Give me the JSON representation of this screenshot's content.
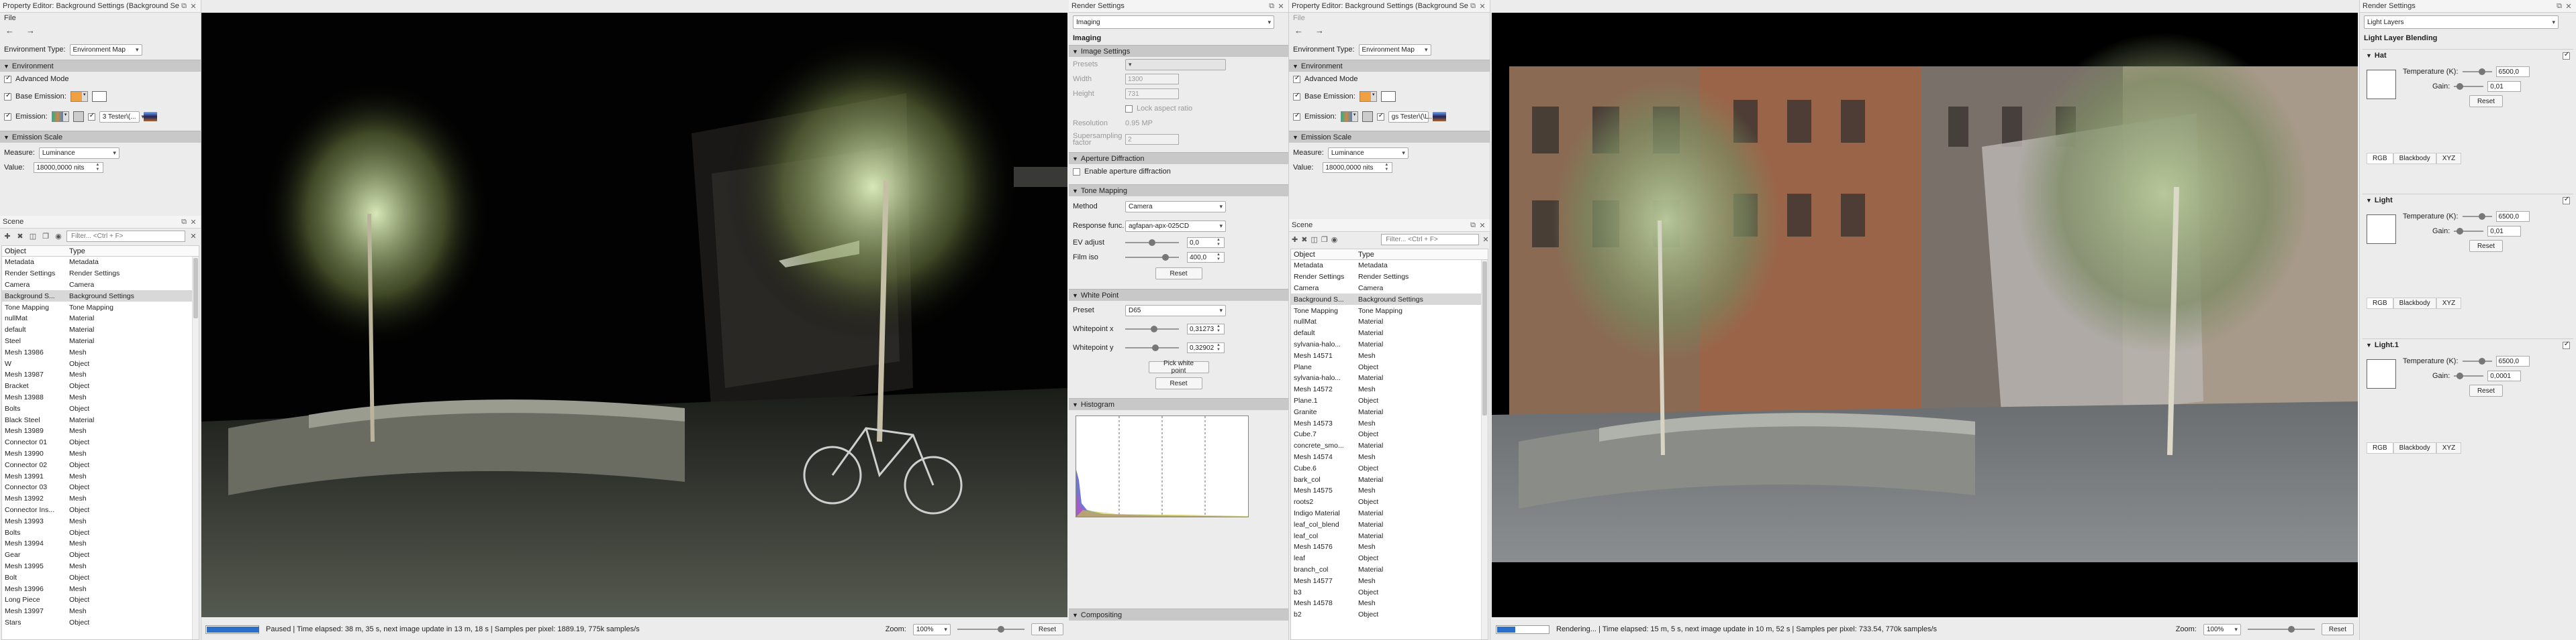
{
  "left_editor": {
    "title": "Property Editor: Background Settings (Background Settings)",
    "menu_file": "File",
    "nav_back": "←",
    "nav_forward": "→",
    "env_type_label": "Environment Type:",
    "env_type_value": "Environment Map",
    "section_environment": "Environment",
    "advanced_mode": "Advanced Mode",
    "base_emission": "Base Emission:",
    "emission_label": "Emission:",
    "emission_map": "3 Tester\\(...",
    "section_emission_scale": "Emission Scale",
    "measure_label": "Measure:",
    "measure_value": "Luminance",
    "value_label": "Value:",
    "value_value": "18000,0000 nits"
  },
  "left_scene": {
    "title": "Scene",
    "filter_placeholder": "Filter... <Ctrl + F>",
    "col_object": "Object",
    "col_type": "Type",
    "rows": [
      [
        "Metadata",
        "Metadata"
      ],
      [
        "Render Settings",
        "Render Settings"
      ],
      [
        "Camera",
        "Camera"
      ],
      [
        "Background S...",
        "Background Settings"
      ],
      [
        "Tone Mapping",
        "Tone Mapping"
      ],
      [
        "nullMat",
        "Material"
      ],
      [
        "default",
        "Material"
      ],
      [
        "Steel",
        "Material"
      ],
      [
        "Mesh 13986",
        "Mesh"
      ],
      [
        "W",
        "Object"
      ],
      [
        "Mesh 13987",
        "Mesh"
      ],
      [
        "Bracket",
        "Object"
      ],
      [
        "Mesh 13988",
        "Mesh"
      ],
      [
        "Bolts",
        "Object"
      ],
      [
        "Black Steel",
        "Material"
      ],
      [
        "Mesh 13989",
        "Mesh"
      ],
      [
        "Connector 01",
        "Object"
      ],
      [
        "Mesh 13990",
        "Mesh"
      ],
      [
        "Connector 02",
        "Object"
      ],
      [
        "Mesh 13991",
        "Mesh"
      ],
      [
        "Connector 03",
        "Object"
      ],
      [
        "Mesh 13992",
        "Mesh"
      ],
      [
        "Connector Ins...",
        "Object"
      ],
      [
        "Mesh 13993",
        "Mesh"
      ],
      [
        "Bolts",
        "Object"
      ],
      [
        "Mesh 13994",
        "Mesh"
      ],
      [
        "Gear",
        "Object"
      ],
      [
        "Mesh 13995",
        "Mesh"
      ],
      [
        "Bolt",
        "Object"
      ],
      [
        "Mesh 13996",
        "Mesh"
      ],
      [
        "Long Piece",
        "Object"
      ],
      [
        "Mesh 13997",
        "Mesh"
      ],
      [
        "Stars",
        "Object"
      ]
    ],
    "selected_index": 3
  },
  "left_status": {
    "status_text": "Paused | Time elapsed: 38 m, 35 s, next image update in 13 m, 18 s | Samples per pixel: 1889.19, 775k samples/s",
    "zoom_label": "Zoom:",
    "zoom_value": "100%",
    "reset": "Reset",
    "progress": 1.0
  },
  "render_settings": {
    "title": "Render Settings",
    "mode_value": "Imaging",
    "heading": "Imaging",
    "section_image_settings": "Image Settings",
    "presets_label": "Presets",
    "width_label": "Width",
    "width_value": "1300",
    "height_label": "Height",
    "height_value": "731",
    "lock_aspect": "Lock aspect ratio",
    "resolution_label": "Resolution",
    "resolution_value": "0.95 MP",
    "supersampling_label": "Supersampling factor",
    "supersampling_value": "2",
    "section_aperture": "Aperture Diffraction",
    "enable_aperture": "Enable aperture diffraction",
    "section_tone": "Tone Mapping",
    "method_label": "Method",
    "method_value": "Camera",
    "response_label": "Response func.",
    "response_value": "agfapan-apx-025CD",
    "ev_label": "EV adjust",
    "ev_value": "0,0",
    "film_label": "Film iso",
    "film_value": "400,0",
    "reset": "Reset",
    "section_white": "White Point",
    "preset_label": "Preset",
    "preset_value": "D65",
    "wx_label": "Whitepoint x",
    "wx_value": "0,31273",
    "wy_label": "Whitepoint y",
    "wy_value": "0,32902",
    "pick_white": "Pick white point",
    "reset2": "Reset",
    "section_histogram": "Histogram",
    "section_compositing": "Compositing"
  },
  "mid_editor": {
    "title": "Property Editor: Background Settings (Background Settings)",
    "menu_file": "File",
    "env_type_label": "Environment Type:",
    "env_type_value": "Environment Map",
    "section_environment": "Environment",
    "advanced_mode": "Advanced Mode",
    "base_emission": "Base Emission:",
    "emission_label": "Emission:",
    "emission_map": "gs Tester\\(\\L...",
    "section_emission_scale": "Emission Scale",
    "measure_label": "Measure:",
    "measure_value": "Luminance",
    "value_label": "Value:",
    "value_value": "18000,0000 nits"
  },
  "mid_scene": {
    "title": "Scene",
    "filter_placeholder": "Filter... <Ctrl + F>",
    "col_object": "Object",
    "col_type": "Type",
    "rows": [
      [
        "Metadata",
        "Metadata"
      ],
      [
        "Render Settings",
        "Render Settings"
      ],
      [
        "Camera",
        "Camera"
      ],
      [
        "Background S...",
        "Background Settings"
      ],
      [
        "Tone Mapping",
        "Tone Mapping"
      ],
      [
        "nullMat",
        "Material"
      ],
      [
        "default",
        "Material"
      ],
      [
        "sylvania-halo...",
        "Material"
      ],
      [
        "Mesh 14571",
        "Mesh"
      ],
      [
        "Plane",
        "Object"
      ],
      [
        "sylvania-halo...",
        "Material"
      ],
      [
        "Mesh 14572",
        "Mesh"
      ],
      [
        "Plane.1",
        "Object"
      ],
      [
        "Granite",
        "Material"
      ],
      [
        "Mesh 14573",
        "Mesh"
      ],
      [
        "Cube.7",
        "Object"
      ],
      [
        "concrete_smo...",
        "Material"
      ],
      [
        "Mesh 14574",
        "Mesh"
      ],
      [
        "Cube.6",
        "Object"
      ],
      [
        "bark_col",
        "Material"
      ],
      [
        "Mesh 14575",
        "Mesh"
      ],
      [
        "roots2",
        "Object"
      ],
      [
        "Indigo Material",
        "Material"
      ],
      [
        "leaf_col_blend",
        "Material"
      ],
      [
        "leaf_col",
        "Material"
      ],
      [
        "Mesh 14576",
        "Mesh"
      ],
      [
        "leaf",
        "Object"
      ],
      [
        "branch_col",
        "Material"
      ],
      [
        "Mesh 14577",
        "Mesh"
      ],
      [
        "b3",
        "Object"
      ],
      [
        "Mesh 14578",
        "Mesh"
      ],
      [
        "b2",
        "Object"
      ]
    ],
    "selected_index": 3
  },
  "right_status": {
    "status_text": "Rendering... | Time elapsed: 15 m, 5 s, next image update in 10 m, 52 s | Samples per pixel: 733.54, 770k samples/s",
    "zoom_label": "Zoom:",
    "zoom_value": "100%",
    "reset": "Reset",
    "progress": 0.35
  },
  "right_render_settings": {
    "title": "Render Settings",
    "mode_value": "Light Layers",
    "heading": "Light Layer Blending",
    "layers": [
      {
        "name": "Hat",
        "temp_label": "Temperature (K):",
        "temp_value": "6500,0",
        "gain_label": "Gain:",
        "gain_value": "0,01",
        "reset": "Reset",
        "tabs": [
          "RGB",
          "Blackbody",
          "XYZ"
        ]
      },
      {
        "name": "Light",
        "temp_label": "Temperature (K):",
        "temp_value": "6500,0",
        "gain_label": "Gain:",
        "gain_value": "0,01",
        "reset": "Reset",
        "tabs": [
          "RGB",
          "Blackbody",
          "XYZ"
        ]
      },
      {
        "name": "Light.1",
        "temp_label": "Temperature (K):",
        "temp_value": "6500,0",
        "gain_label": "Gain:",
        "gain_value": "0,0001",
        "reset": "Reset",
        "tabs": [
          "RGB",
          "Blackbody",
          "XYZ"
        ]
      }
    ]
  }
}
